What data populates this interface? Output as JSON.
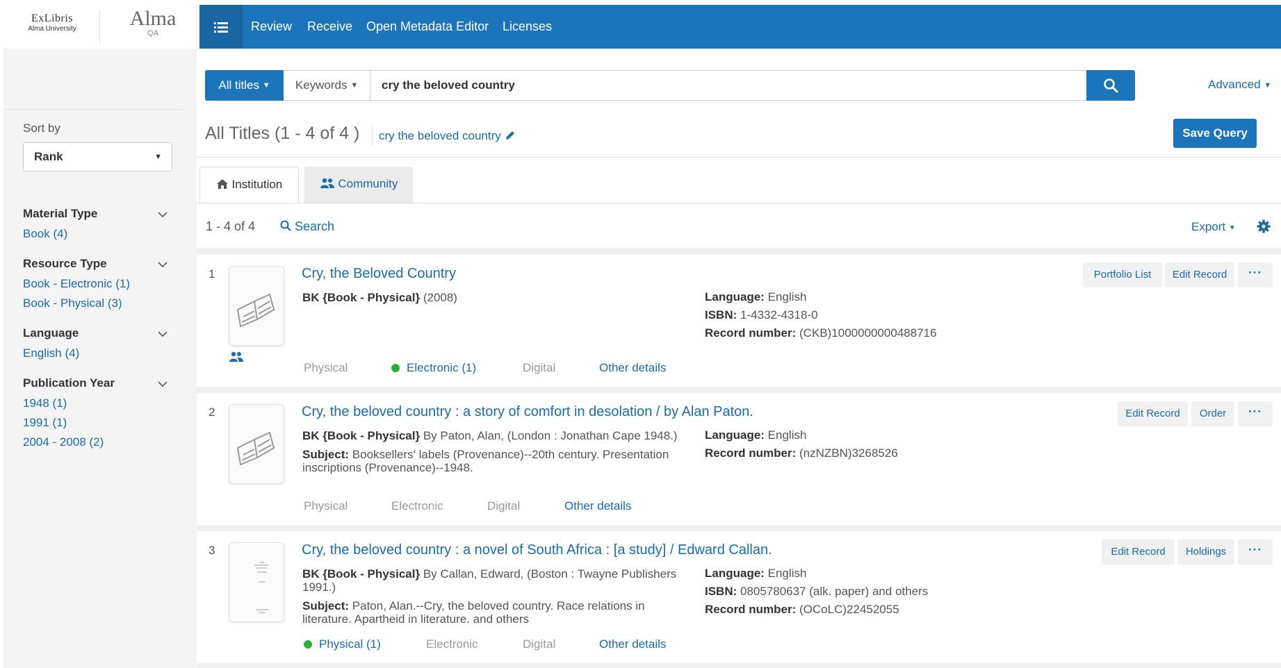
{
  "header": {
    "logo_line1": "ExLibris",
    "logo_line2": "Alma University",
    "product": "Alma",
    "env": "QA",
    "nav": [
      "Review",
      "Receive",
      "Open Metadata Editor",
      "Licenses"
    ]
  },
  "sidebar": {
    "sort_label": "Sort by",
    "sort_value": "Rank",
    "facets": [
      {
        "title": "Material Type",
        "items": [
          "Book (4)"
        ]
      },
      {
        "title": "Resource Type",
        "items": [
          "Book - Electronic (1)",
          "Book - Physical (3)"
        ]
      },
      {
        "title": "Language",
        "items": [
          "English (4)"
        ]
      },
      {
        "title": "Publication Year",
        "items": [
          "1948 (1)",
          "1991 (1)",
          "2004 - 2008 (2)"
        ]
      }
    ]
  },
  "search": {
    "scope": "All titles",
    "field": "Keywords",
    "query": "cry the beloved country",
    "advanced": "Advanced"
  },
  "results_header": {
    "title": "All Titles (1 - 4 of 4 )",
    "query_link": "cry the beloved country",
    "save_query": "Save Query",
    "tabs": [
      "Institution",
      "Community"
    ],
    "count": "1 - 4 of 4",
    "search_link": "Search",
    "export": "Export"
  },
  "results": [
    {
      "num": "1",
      "title": "Cry, the Beloved Country",
      "type": "BK {Book - Physical}",
      "pub": " (2008)",
      "subject_label": "",
      "subject": "",
      "language_label": "Language:",
      "language": " English",
      "isbn_label": "ISBN:",
      "isbn": " 1-4332-4318-0",
      "record_label": "Record number:",
      "record": " (CKB)1000000000488716",
      "availability": [
        "Physical",
        "Electronic (1)",
        "Digital",
        "Other details"
      ],
      "actions": [
        "Portfolio List",
        "Edit Record"
      ],
      "more": "···"
    },
    {
      "num": "2",
      "title": "Cry, the beloved country : a story of comfort in desolation / by Alan Paton.",
      "type": "BK {Book - Physical}",
      "pub": " By Paton, Alan, (London : Jonathan Cape 1948.)",
      "subject_label": "Subject:",
      "subject": " Booksellers' labels (Provenance)--20th century. Presentation inscriptions (Provenance)--1948.",
      "language_label": "Language:",
      "language": " English",
      "isbn_label": "",
      "isbn": "",
      "record_label": "Record number:",
      "record": " (nzNZBN)3268526",
      "availability": [
        "Physical",
        "Electronic",
        "Digital",
        "Other details"
      ],
      "actions": [
        "Edit Record",
        "Order"
      ],
      "more": "···"
    },
    {
      "num": "3",
      "title": "Cry, the beloved country : a novel of South Africa : [a study] / Edward Callan.",
      "type": "BK {Book - Physical}",
      "pub": " By Callan, Edward, (Boston : Twayne Publishers 1991.)",
      "subject_label": "Subject:",
      "subject": " Paton, Alan.--Cry, the beloved country. Race relations in literature. Apartheid in literature. and others",
      "language_label": "Language:",
      "language": " English",
      "isbn_label": "ISBN:",
      "isbn": " 0805780637 (alk. paper) and others",
      "record_label": "Record number:",
      "record": " (OCoLC)22452055",
      "availability": [
        "Physical (1)",
        "Electronic",
        "Digital",
        "Other details"
      ],
      "actions": [
        "Edit Record",
        "Holdings"
      ],
      "more": "···"
    }
  ],
  "colors": {
    "brand_blue": "#1c74ba",
    "link_blue": "#1c6aa6",
    "available_green": "#2fae34"
  }
}
